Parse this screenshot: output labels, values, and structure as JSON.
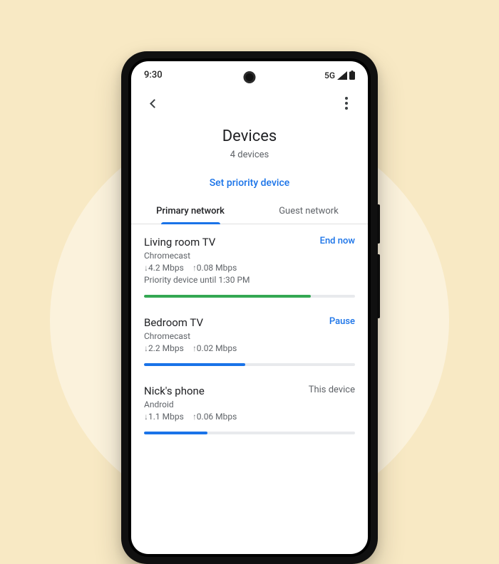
{
  "statusbar": {
    "time": "9:30",
    "signal": "5G"
  },
  "page": {
    "title": "Devices",
    "subtitle": "4 devices",
    "priority_link": "Set priority device"
  },
  "tabs": {
    "primary": "Primary network",
    "guest": "Guest network"
  },
  "devices": [
    {
      "name": "Living room TV",
      "type": "Chromecast",
      "down": "4.2 Mbps",
      "up": "0.08 Mbps",
      "priority_note": "Priority device until 1:30 PM",
      "action": "End now",
      "action_dim": false,
      "bar_pct": "79%",
      "bar_color": "green"
    },
    {
      "name": "Bedroom TV",
      "type": "Chromecast",
      "down": "2.2 Mbps",
      "up": "0.02 Mbps",
      "priority_note": "",
      "action": "Pause",
      "action_dim": false,
      "bar_pct": "48%",
      "bar_color": "blue"
    },
    {
      "name": "Nick's phone",
      "type": "Android",
      "down": "1.1 Mbps",
      "up": "0.06 Mbps",
      "priority_note": "",
      "action": "This device",
      "action_dim": true,
      "bar_pct": "30%",
      "bar_color": "blue"
    }
  ]
}
